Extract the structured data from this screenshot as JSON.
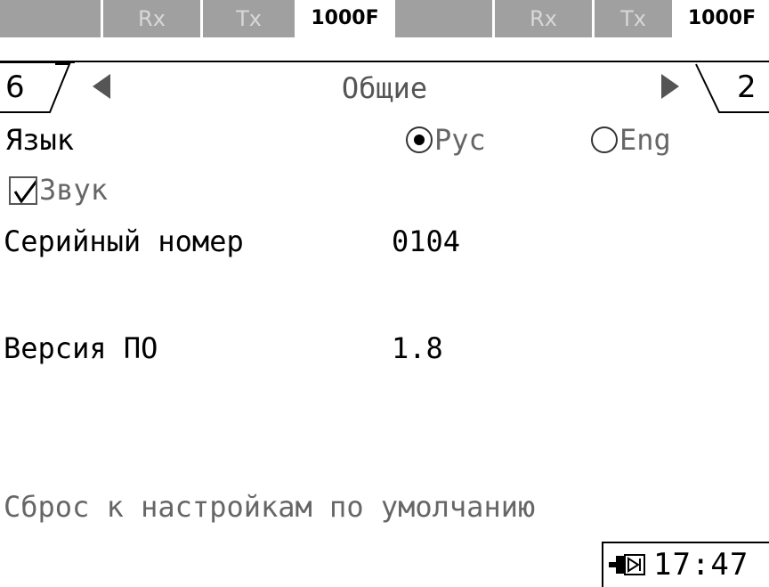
{
  "status_bar": {
    "cells": [
      {
        "label": ""
      },
      {
        "label": "Rx"
      },
      {
        "label": "Tx"
      },
      {
        "label": "1000F"
      },
      {
        "label": ""
      },
      {
        "label": "Rx"
      },
      {
        "label": "Tx"
      },
      {
        "label": "1000F"
      }
    ]
  },
  "header": {
    "left_tab_number": "6",
    "right_tab_number": "2",
    "title": "Общие",
    "prev_icon": "triangle-left-icon",
    "next_icon": "triangle-right-icon"
  },
  "settings": {
    "language": {
      "label": "Язык",
      "options": [
        {
          "label": "Рус",
          "selected": true
        },
        {
          "label": "Eng",
          "selected": false
        }
      ]
    },
    "sound": {
      "label": "Звук",
      "checked": true
    },
    "serial": {
      "label": "Серийный номер",
      "value": "0104"
    },
    "version": {
      "label": "Версия ПО",
      "value": "1.8"
    },
    "reset": {
      "label": "Сброс к настройкам по умолчанию"
    }
  },
  "footer": {
    "time": "17:47",
    "power_icon": "power-plug-icon"
  },
  "colors": {
    "status_gray": "#a0a0a0",
    "muted_text": "#666666"
  }
}
